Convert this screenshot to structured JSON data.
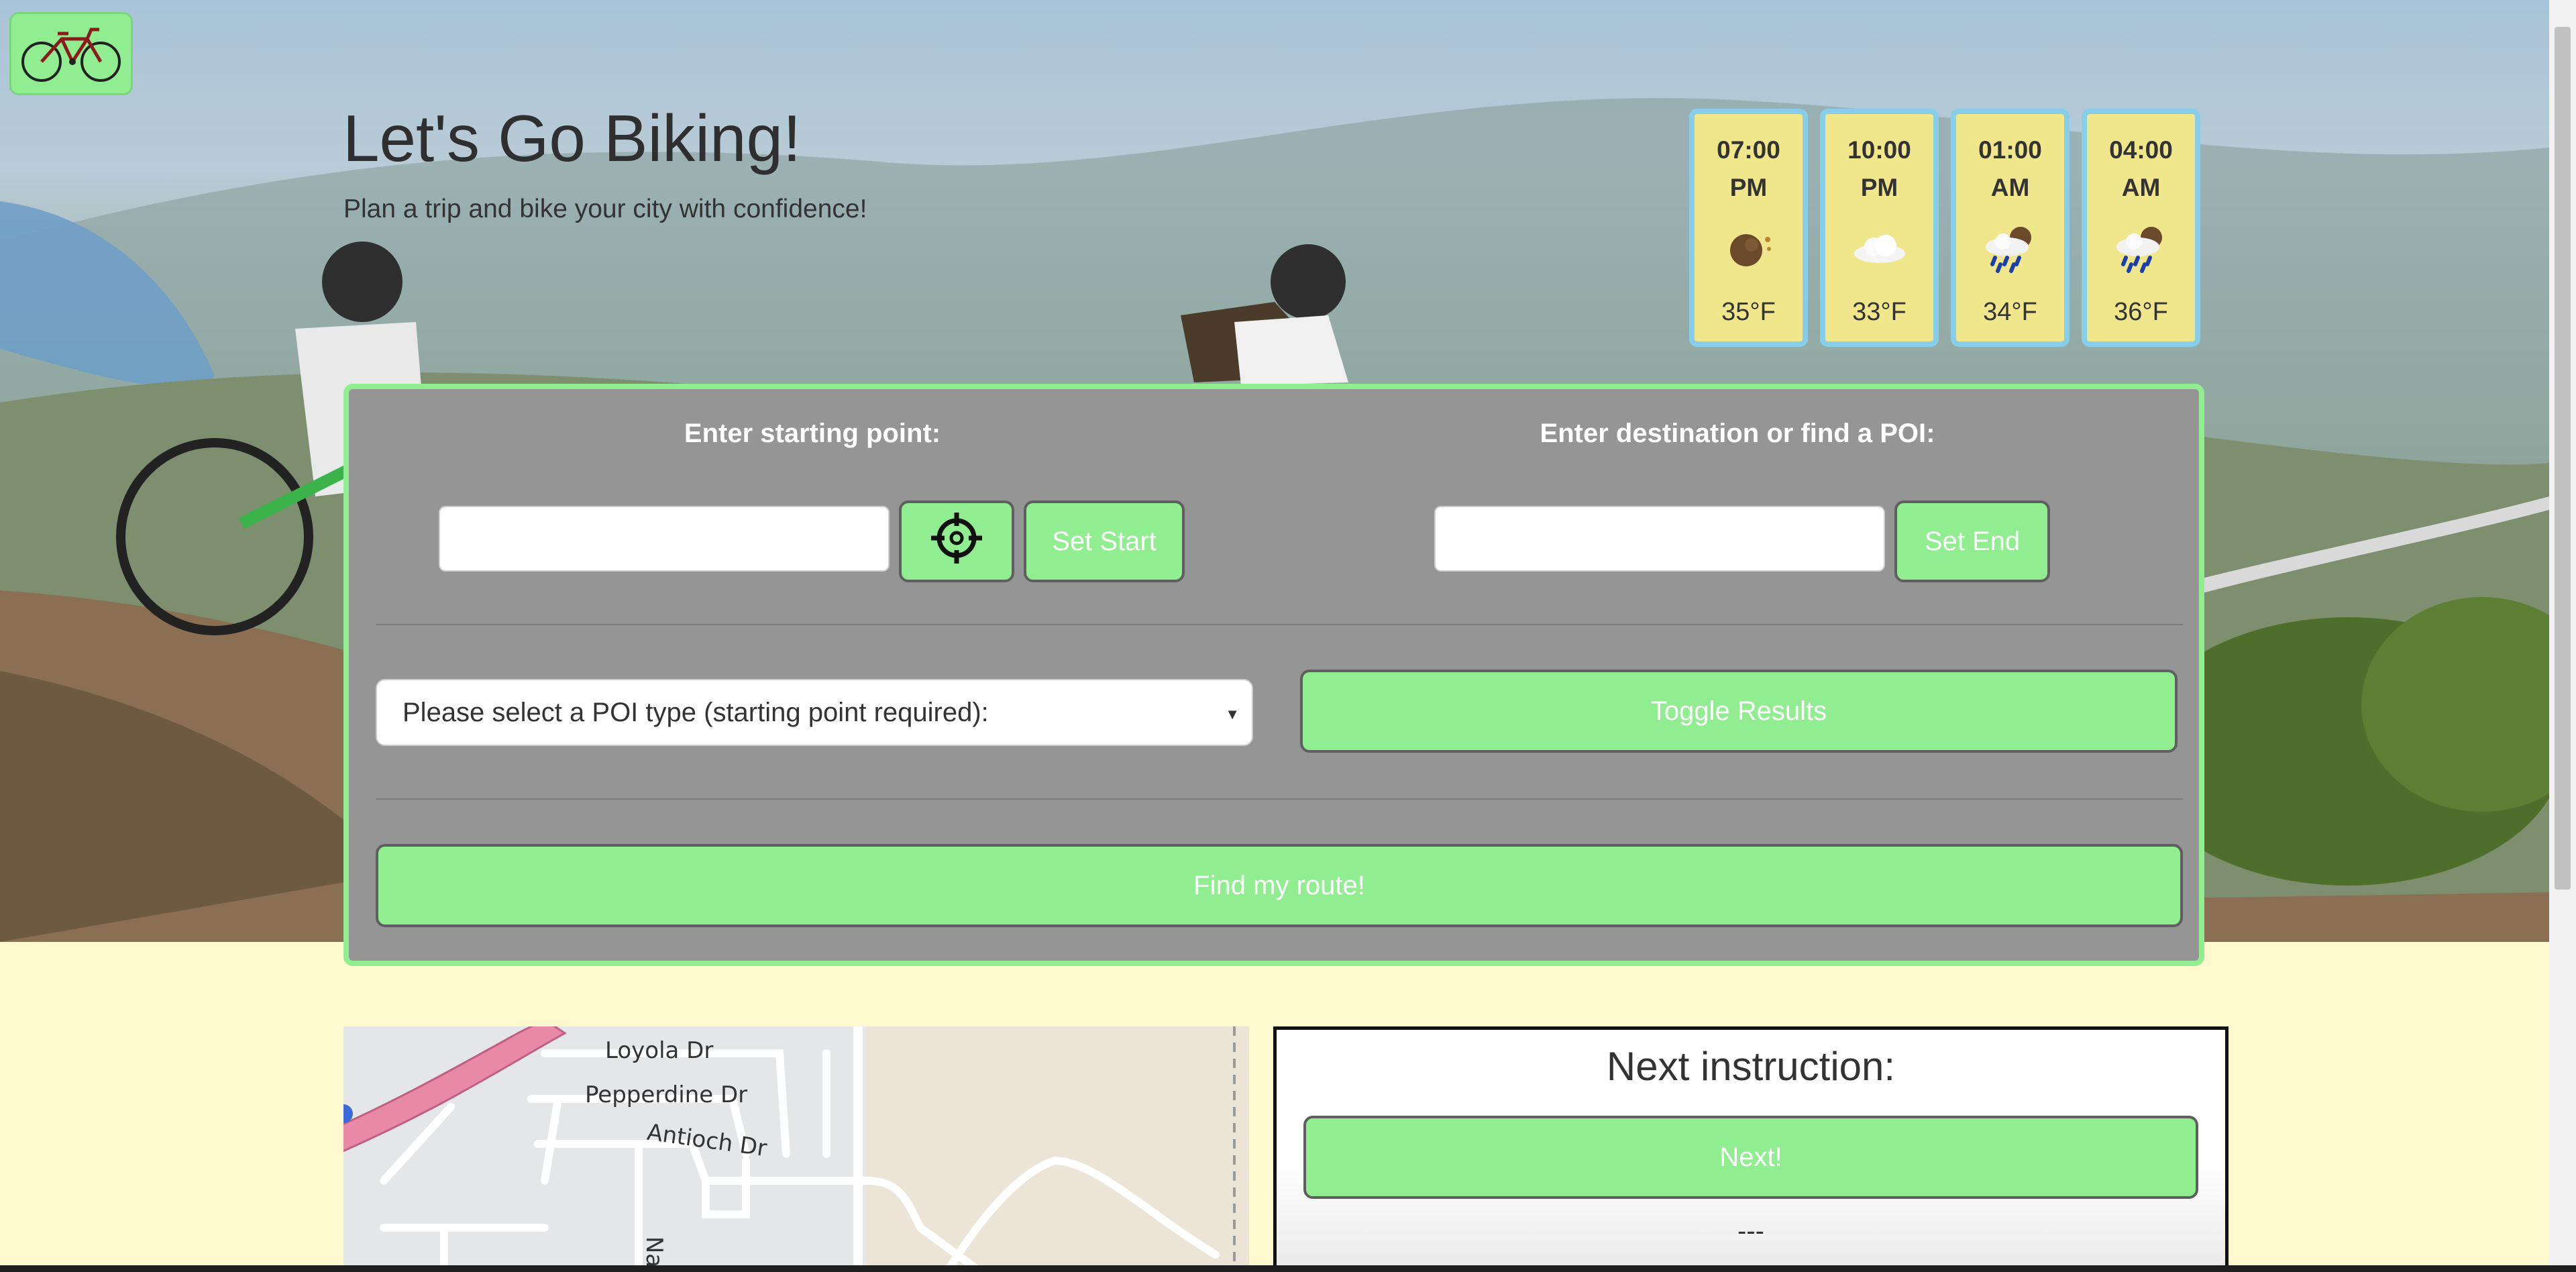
{
  "header": {
    "title": "Let's Go Biking!",
    "subtitle": "Plan a trip and bike your city with confidence!"
  },
  "logo": {
    "icon": "bicycle-icon"
  },
  "weather": [
    {
      "time": "07:00 PM",
      "icon": "moon-icon",
      "temp": "35°F"
    },
    {
      "time": "10:00 PM",
      "icon": "cloud-icon",
      "temp": "33°F"
    },
    {
      "time": "01:00 AM",
      "icon": "rain-night-icon",
      "temp": "34°F"
    },
    {
      "time": "04:00 AM",
      "icon": "rain-night-icon",
      "temp": "36°F"
    }
  ],
  "panel": {
    "start_label": "Enter starting point:",
    "start_value": "",
    "locate_icon": "crosshair-icon",
    "set_start": "Set Start",
    "end_label": "Enter destination or find a POI:",
    "end_value": "",
    "set_end": "Set End",
    "poi_select": "Please select a POI type (starting point required):",
    "toggle_results": "Toggle Results",
    "find_route": "Find my route!"
  },
  "map": {
    "streets": [
      "Loyola Dr",
      "Pepperdine Dr",
      "Antioch Dr",
      "Na"
    ]
  },
  "instructions": {
    "heading": "Next instruction:",
    "next_button": "Next!",
    "current": "---"
  },
  "colors": {
    "accent_green": "#90ee90",
    "panel_gray": "#959595",
    "page_bg": "#fdf8cd",
    "weather_card": "#f0e68c",
    "weather_border": "#87ceeb"
  }
}
